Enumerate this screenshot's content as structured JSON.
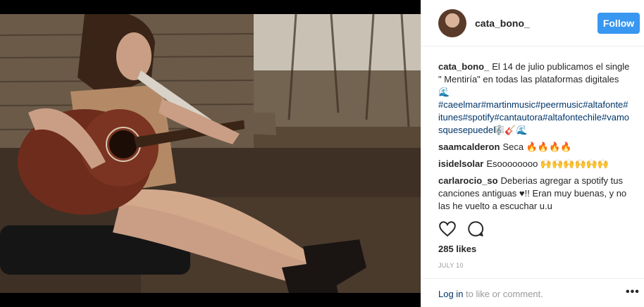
{
  "post": {
    "username": "cata_bono_",
    "follow_label": "Follow",
    "caption": {
      "user": "cata_bono_",
      "text": "El 14 de julio publicamos el single \" Mentiría\" en todas las plataformas digitales 🌊",
      "hashtags": "#caeelmar#martinmusic#peermusic#altafonte#itunes#spotify#cantautora#altafontechile#vamosquesepuede🎼🎸🌊"
    },
    "comments": [
      {
        "user": "saamcalderon",
        "text": "Seca 🔥🔥🔥🔥"
      },
      {
        "user": "isidelsolar",
        "text": "Esoooooooo 🙌🙌🙌🙌🙌🙌"
      },
      {
        "user": "carlarocio_so",
        "text": "Deberias agregar a spotify tus canciones antiguas ♥!! Eran muy buenas, y no las he vuelto a escuchar u.u"
      }
    ],
    "likes": "285 likes",
    "date": "JULY 10",
    "login_link": "Log in",
    "login_rest": " to like or comment.",
    "more_label": "•••",
    "icons": {
      "like": "heart-icon",
      "comment": "comment-icon",
      "more": "more-options-icon"
    },
    "colors": {
      "accent": "#3897f0",
      "hashtag": "#003569",
      "muted": "#999999"
    }
  }
}
